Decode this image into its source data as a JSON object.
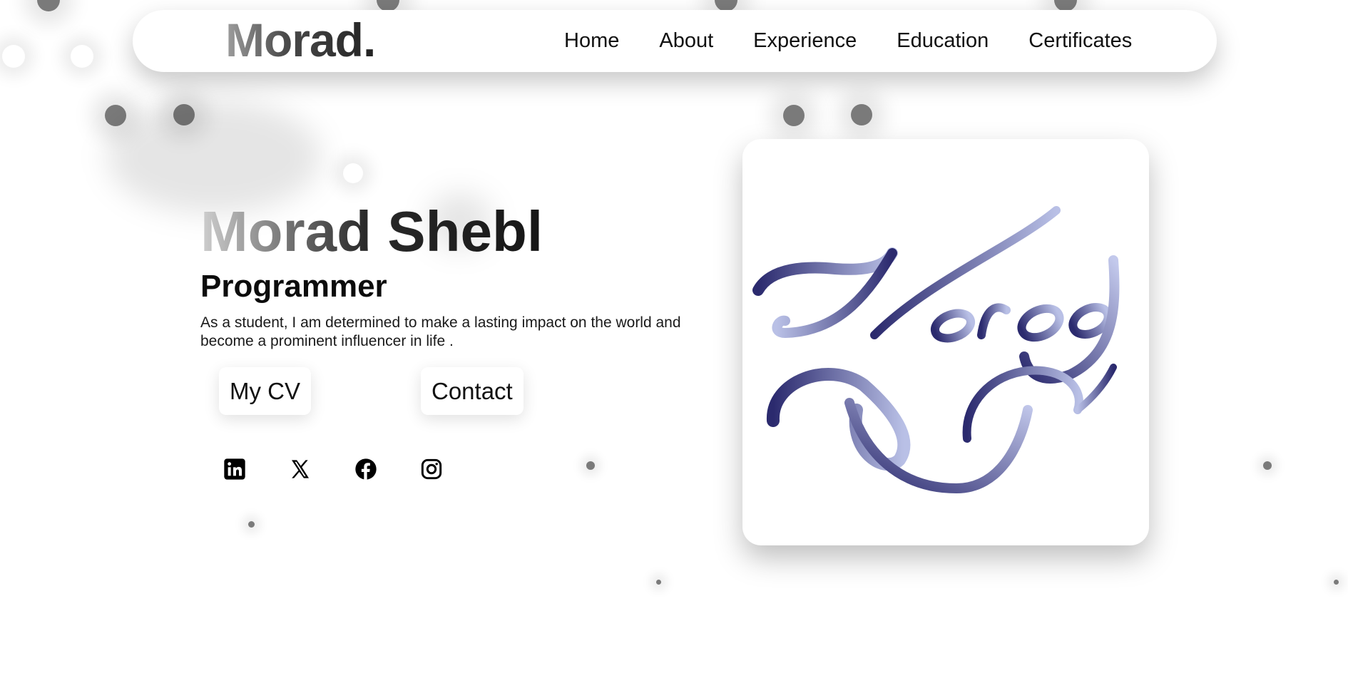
{
  "nav": {
    "logo": "Morad.",
    "links": [
      "Home",
      "About",
      "Experience",
      "Education",
      "Certificates"
    ]
  },
  "hero": {
    "name": "Morad Shebl",
    "role": "Programmer",
    "description": "As a student, I am determined to make a lasting impact on the world and become a prominent influencer in life .",
    "buttons": {
      "cv": "My CV",
      "contact": "Contact"
    },
    "socials": [
      "linkedin-icon",
      "x-icon",
      "facebook-icon",
      "instagram-icon"
    ]
  },
  "logo_image": {
    "text": "Morad",
    "colors": [
      "#2b2a6e",
      "#b9c0e6"
    ]
  },
  "colors": {
    "background": "#ffffff",
    "text": "#111111",
    "dot": "#7a7a7a"
  }
}
